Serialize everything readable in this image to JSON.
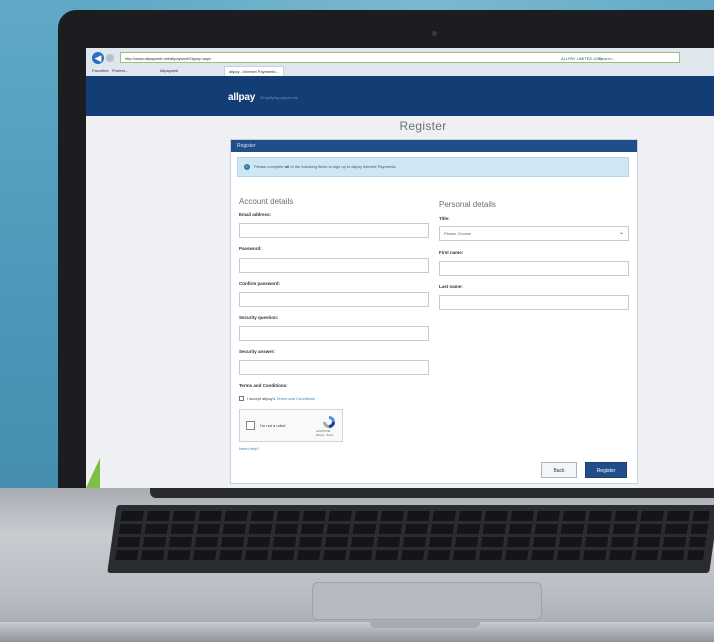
{
  "browser": {
    "address": "http://www.allpayweb.net/allpayweb/Signup.aspx",
    "ssl_label": "ALLPAY LIMITED (GB)",
    "search_placeholder": "Search...",
    "tabs": [
      "Favorites · Protect...",
      "Allpayweb",
      "allpay - Internet Payments..."
    ]
  },
  "site": {
    "logo": "allpay",
    "tagline": "Simplifying payments",
    "page_title": "Register"
  },
  "panel": {
    "header": "Register",
    "info_prefix": "Please complete ",
    "info_bold": "all",
    "info_suffix": " of the following fields to sign up to allpay Internet Payments."
  },
  "account": {
    "title": "Account details",
    "email_label": "Email address:",
    "password_label": "Password:",
    "confirm_label": "Confirm password:",
    "question_label": "Security question:",
    "answer_label": "Security answer:",
    "terms_heading": "Terms and Conditions:",
    "terms_text": "I accept allpay's ",
    "terms_link": "Terms and Conditions"
  },
  "personal": {
    "title": "Personal details",
    "title_label": "Title:",
    "title_value": "Please Choose",
    "first_label": "First name:",
    "last_label": "Last name:"
  },
  "captcha": {
    "label": "I'm not a robot",
    "brand": "reCAPTCHA",
    "footer": "Privacy · Terms"
  },
  "help_link": "Need help?",
  "buttons": {
    "back": "Back",
    "register": "Register"
  }
}
